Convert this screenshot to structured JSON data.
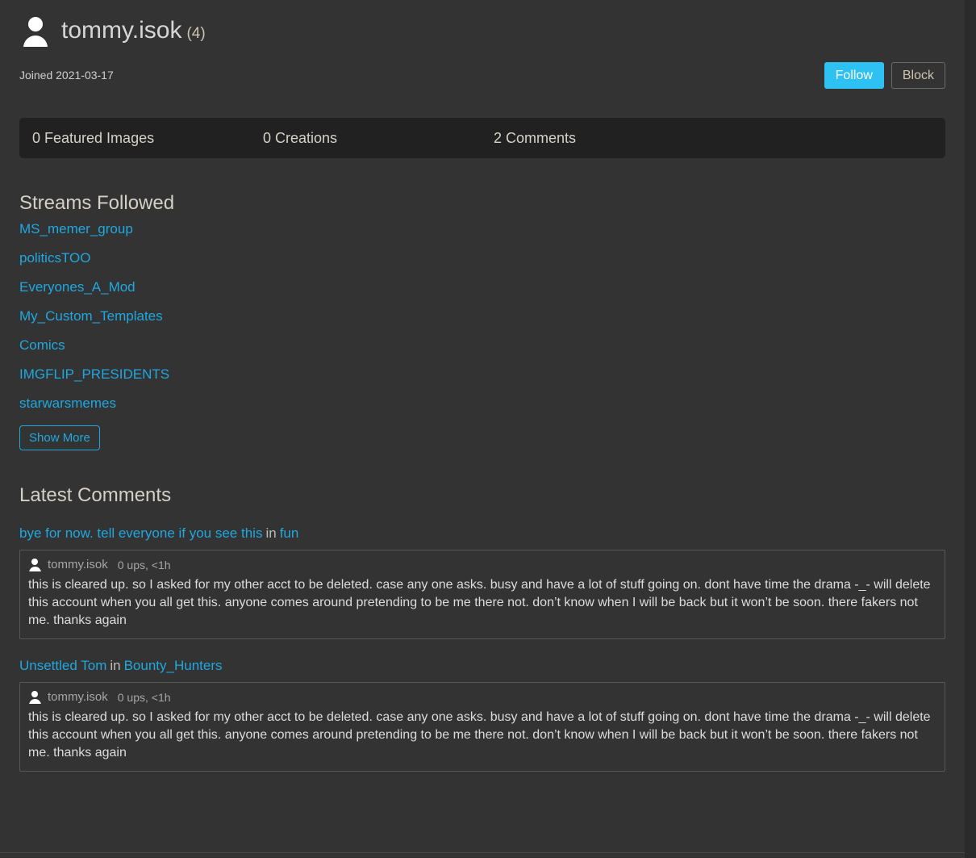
{
  "profile": {
    "avatar_icon": "user-avatar-icon",
    "username": "tommy.isok",
    "user_count": "(4)",
    "joined": "Joined 2021-03-17",
    "follow_label": "Follow",
    "block_label": "Block",
    "follow_color": "#2ec2f3",
    "link_color": "#1fa8e0"
  },
  "stats": {
    "featured_images": "0 Featured Images",
    "creations": "0 Creations",
    "comments": "2 Comments"
  },
  "streams": {
    "title": "Streams Followed",
    "items": [
      {
        "label": "MS_memer_group"
      },
      {
        "label": "politicsTOO"
      },
      {
        "label": "Everyones_A_Mod"
      },
      {
        "label": "My_Custom_Templates"
      },
      {
        "label": "Comics"
      },
      {
        "label": "IMGFLIP_PRESIDENTS"
      },
      {
        "label": "starwarsmemes"
      }
    ],
    "show_more_label": "Show More"
  },
  "comments": {
    "title": "Latest Comments",
    "items": [
      {
        "post_title": "bye for now. tell everyone if you see this",
        "separator": "in",
        "stream": "fun",
        "author": "tommy.isok",
        "meta": "0 ups, <1h",
        "body": "this is cleared up. so I asked for my other acct to be deleted. case any one asks. busy and have a lot of stuff going on. dont have time the drama -_- will delete this account when you all get this. anyone comes around pretending to be me there not. don’t know when I will be back but it won’t be soon. there fakers not me. thanks again"
      },
      {
        "post_title": "Unsettled Tom",
        "separator": "in",
        "stream": "Bounty_Hunters",
        "author": "tommy.isok",
        "meta": "0 ups, <1h",
        "body": "this is cleared up. so I asked for my other acct to be deleted. case any one asks. busy and have a lot of stuff going on. dont have time the drama -_- will delete this account when you all get this. anyone comes around pretending to be me there not. don’t know when I will be back but it won’t be soon. there fakers not me. thanks again"
      }
    ]
  }
}
